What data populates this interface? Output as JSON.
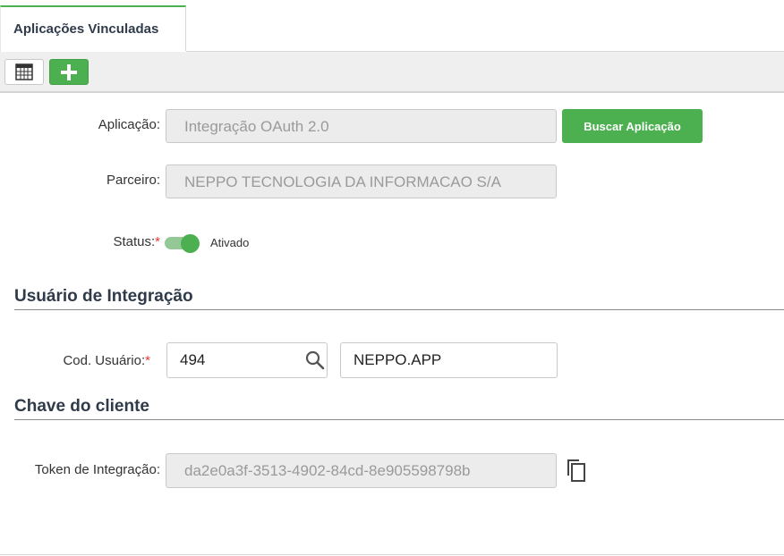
{
  "tab": {
    "label": "Aplicações Vinculadas"
  },
  "toolbar": {
    "table_icon": "table-grid-icon",
    "add_icon": "plus-icon"
  },
  "form": {
    "aplicacao": {
      "label": "Aplicação:",
      "value": "Integração OAuth 2.0",
      "button_label": "Buscar Aplicação"
    },
    "parceiro": {
      "label": "Parceiro:",
      "value": "NEPPO TECNOLOGIA DA INFORMACAO S/A"
    },
    "status": {
      "label": "Status:",
      "required_mark": "*",
      "value_label": "Ativado",
      "enabled": true
    }
  },
  "usuario_section": {
    "title": "Usuário de Integração",
    "cod_usuario": {
      "label": "Cod. Usuário:",
      "required_mark": "*",
      "code": "494",
      "name": "NEPPO.APP",
      "search_icon": "search-icon"
    }
  },
  "chave_section": {
    "title": "Chave do cliente",
    "token": {
      "label": "Token de Integração:",
      "value": "da2e0a3f-3513-4902-84cd-8e905598798b",
      "copy_icon": "copy-icon"
    }
  },
  "colors": {
    "accent": "#4cb050",
    "heading": "#2f3b4a",
    "required": "#e53935"
  }
}
